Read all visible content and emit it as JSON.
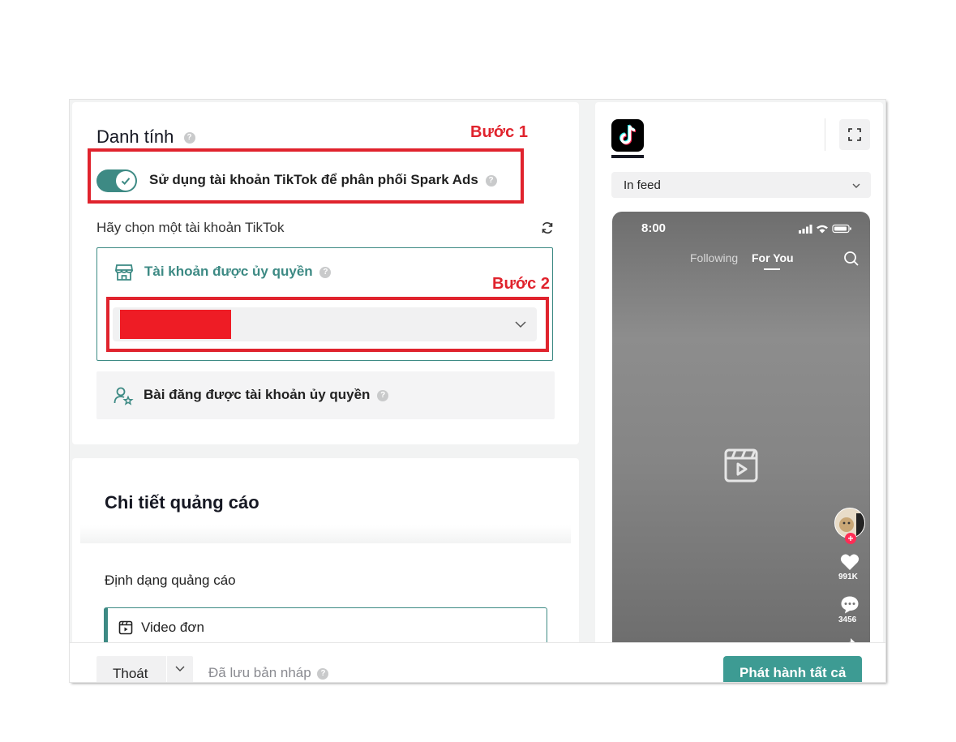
{
  "identity": {
    "title": "Danh tính",
    "step1": "Bước 1",
    "spark_toggle_label": "Sử dụng tài khoản TikTok để phân phối Spark Ads",
    "choose_account_label": "Hãy chọn một tài khoản TikTok",
    "authorized_account_label": "Tài khoản được ủy quyền",
    "step2": "Bước 2",
    "authorized_post_label": "Bài đăng được tài khoản ủy quyền"
  },
  "ad_details": {
    "title": "Chi tiết quảng cáo",
    "format_label": "Định dạng quảng cáo",
    "format_option": "Video đơn"
  },
  "preview": {
    "placement": "In feed",
    "time": "8:00",
    "tab_following": "Following",
    "tab_for_you": "For You",
    "likes": "991K",
    "comments": "3456"
  },
  "footer": {
    "exit_label": "Thoát",
    "draft_status": "Đã lưu bản nháp",
    "publish_label": "Phát hành tất cả"
  },
  "colors": {
    "accent": "#3d8a84",
    "annotation": "#e0232d",
    "redaction": "#ee1c25"
  }
}
